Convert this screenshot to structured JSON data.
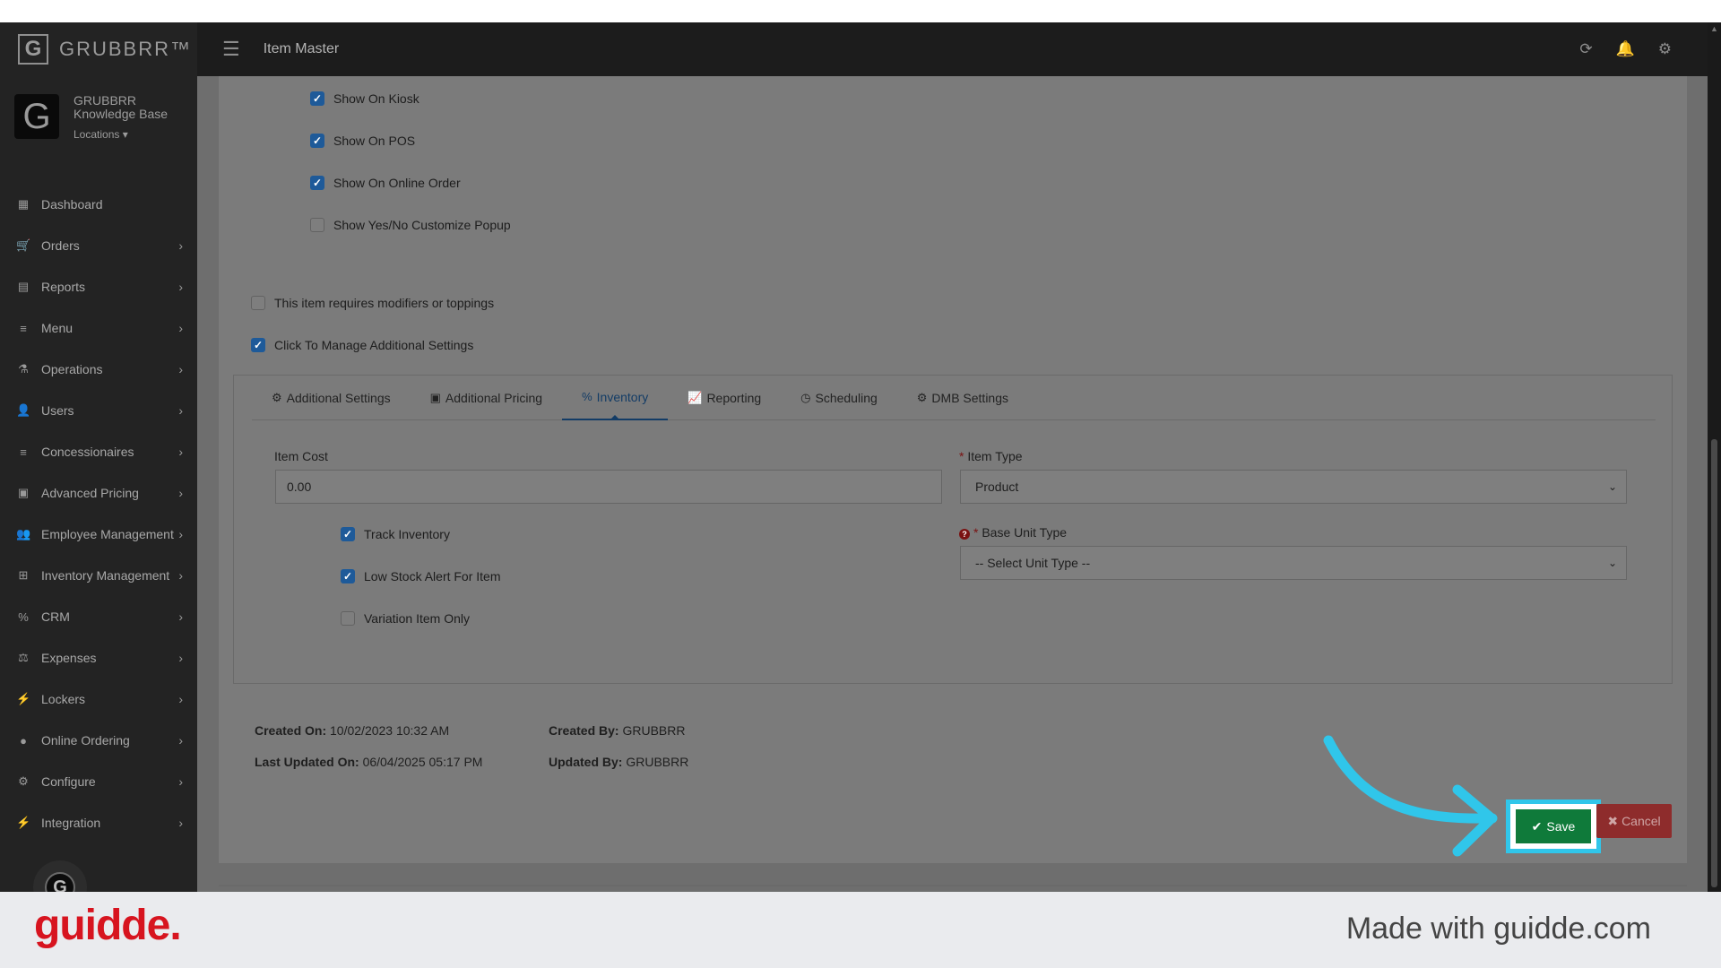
{
  "app": {
    "brand": "GRUBBRR™",
    "page_title": "Item Master",
    "account_name": "GRUBBRR Knowledge Base",
    "locations_label": "Locations"
  },
  "sidebar": {
    "items": [
      {
        "label": "Dashboard",
        "icon": "dashboard-icon"
      },
      {
        "label": "Orders",
        "icon": "cart-icon"
      },
      {
        "label": "Reports",
        "icon": "report-icon"
      },
      {
        "label": "Menu",
        "icon": "list-icon"
      },
      {
        "label": "Operations",
        "icon": "flask-icon"
      },
      {
        "label": "Users",
        "icon": "user-plus-icon"
      },
      {
        "label": "Concessionaires",
        "icon": "list-icon"
      },
      {
        "label": "Advanced Pricing",
        "icon": "money-icon"
      },
      {
        "label": "Employee Management",
        "icon": "users-icon"
      },
      {
        "label": "Inventory Management",
        "icon": "sitemap-icon"
      },
      {
        "label": "CRM",
        "icon": "link-icon"
      },
      {
        "label": "Expenses",
        "icon": "scale-icon"
      },
      {
        "label": "Lockers",
        "icon": "plug-icon"
      },
      {
        "label": "Online Ordering",
        "icon": "globe-icon"
      },
      {
        "label": "Configure",
        "icon": "gear-icon"
      },
      {
        "label": "Integration",
        "icon": "plug-icon"
      }
    ]
  },
  "visibility": {
    "show_on_kiosk": "Show On Kiosk",
    "show_on_pos": "Show On POS",
    "show_on_online_order": "Show On Online Order",
    "show_yes_no_popup": "Show Yes/No Customize Popup",
    "requires_modifiers": "This item requires modifiers or toppings",
    "manage_additional_settings": "Click To Manage Additional Settings"
  },
  "tabs": [
    {
      "label": "Additional Settings",
      "icon": "gear-icon",
      "active": false
    },
    {
      "label": "Additional Pricing",
      "icon": "money-icon",
      "active": false
    },
    {
      "label": "Inventory",
      "icon": "percent-icon",
      "active": true
    },
    {
      "label": "Reporting",
      "icon": "line-chart-icon",
      "active": false
    },
    {
      "label": "Scheduling",
      "icon": "clock-icon",
      "active": false
    },
    {
      "label": "DMB Settings",
      "icon": "gear-icon",
      "active": false
    }
  ],
  "inventory": {
    "item_cost_label": "Item Cost",
    "item_cost_value": "0.00",
    "track_inventory": "Track Inventory",
    "low_stock_alert": "Low Stock Alert For Item",
    "variation_only": "Variation Item Only",
    "required_mark": "*",
    "item_type_label": "Item Type",
    "item_type_value": "Product",
    "base_unit_label": "Base Unit Type",
    "base_unit_value": "-- Select Unit Type --"
  },
  "meta": {
    "created_on_label": "Created On:",
    "created_on_value": "10/02/2023 10:32 AM",
    "last_updated_label": "Last Updated On:",
    "last_updated_value": "06/04/2025 05:17 PM",
    "created_by_label": "Created By:",
    "created_by_value": "GRUBBRR",
    "updated_by_label": "Updated By:",
    "updated_by_value": "GRUBBRR"
  },
  "actions": {
    "save_label": "Save",
    "cancel_label": "Cancel"
  },
  "footer": {
    "logo": "guidde.",
    "made_with": "Made with guidde.com"
  },
  "colors": {
    "save": "#0f7a3a",
    "cancel": "#8e2c2c",
    "highlight": "#30c6ea",
    "guidde_red": "#d7141f",
    "active_tab": "#133c66"
  }
}
